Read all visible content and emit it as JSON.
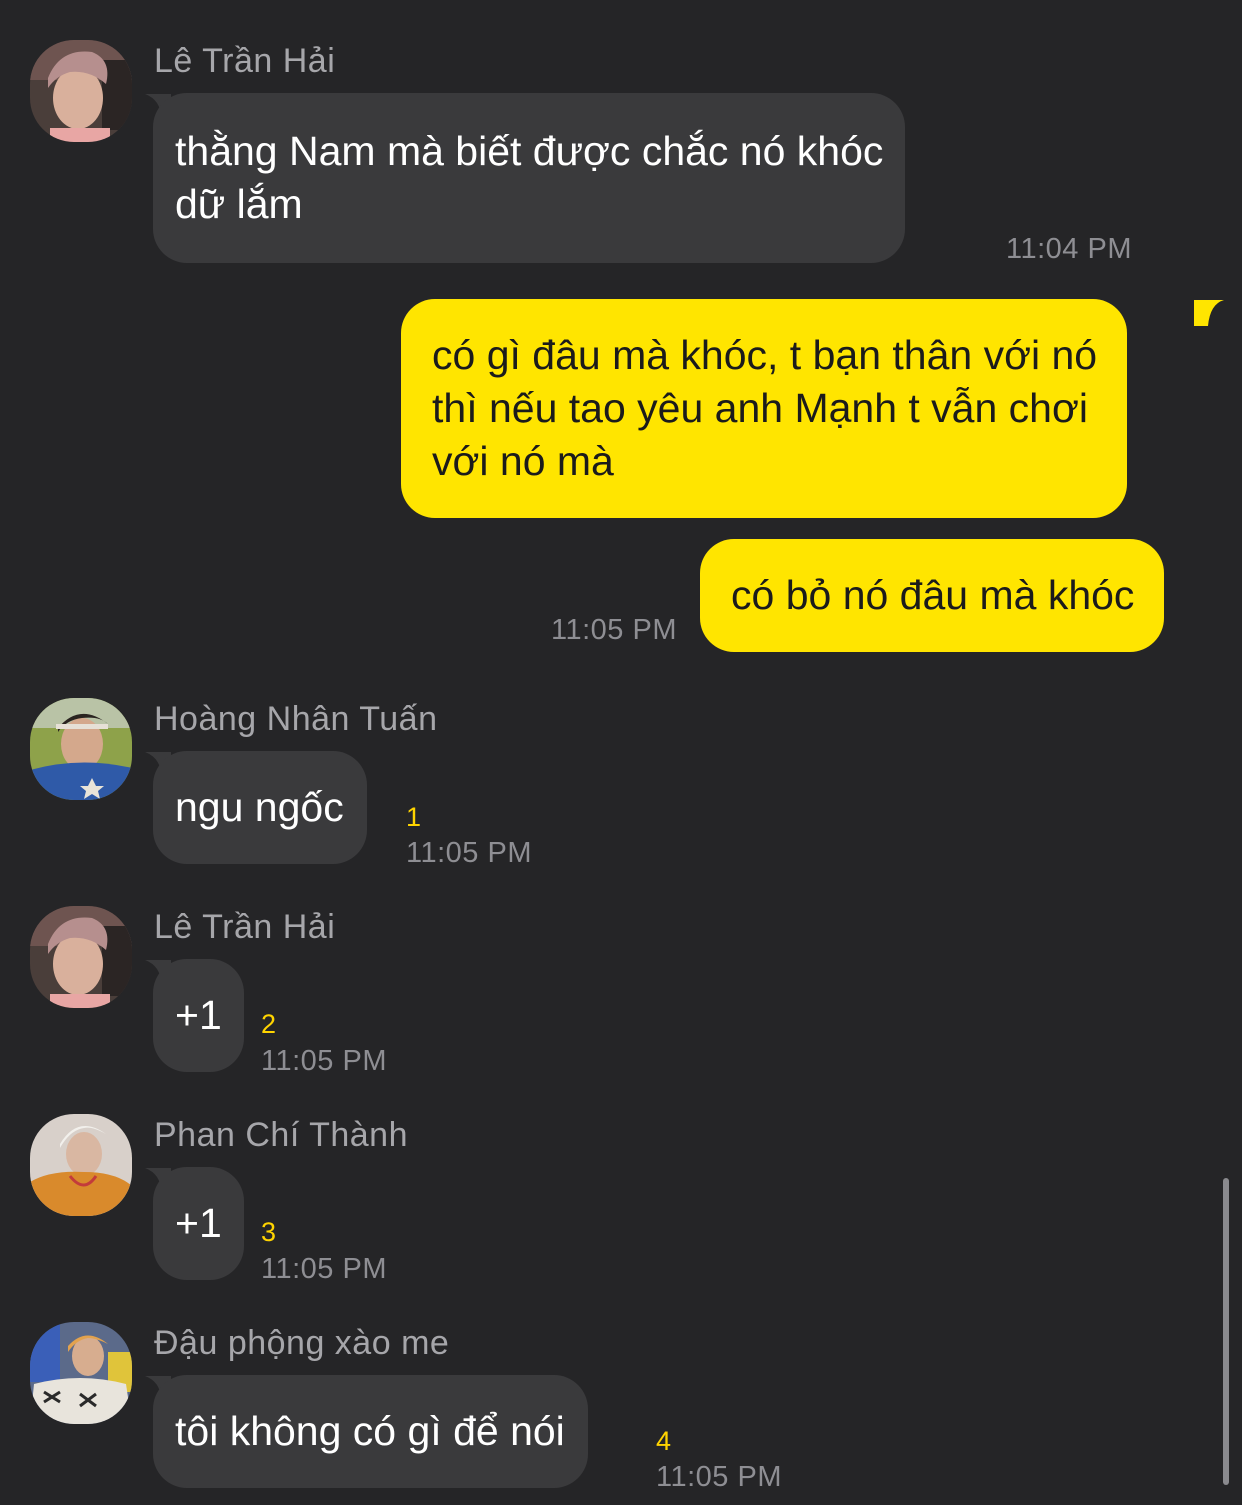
{
  "colors": {
    "background": "#252527",
    "incoming_bubble": "#3a3a3c",
    "outgoing_bubble": "#ffe500",
    "unread_count": "#ffd400",
    "timestamp": "#8e8e93",
    "sender_name": "#a6a6aa"
  },
  "messages": [
    {
      "sender": "Lê Trần Hải",
      "lines": [
        "thằng Nam mà biết được chắc nó khóc",
        "dữ lắm"
      ],
      "time": "11:04 PM",
      "direction": "incoming"
    },
    {
      "lines": [
        "có gì đâu mà khóc, t bạn thân với nó",
        "thì nếu tao yêu anh Mạnh t vẫn chơi",
        "với nó mà"
      ],
      "direction": "outgoing"
    },
    {
      "lines": [
        "có bỏ nó đâu mà khóc"
      ],
      "time": "11:05 PM",
      "direction": "outgoing"
    },
    {
      "sender": "Hoàng Nhân Tuấn",
      "lines": [
        "ngu ngốc"
      ],
      "count": "1",
      "time": "11:05 PM",
      "direction": "incoming"
    },
    {
      "sender": "Lê Trần Hải",
      "lines": [
        "+1"
      ],
      "count": "2",
      "time": "11:05 PM",
      "direction": "incoming"
    },
    {
      "sender": "Phan Chí Thành",
      "lines": [
        "+1"
      ],
      "count": "3",
      "time": "11:05 PM",
      "direction": "incoming"
    },
    {
      "sender": "Đậu phộng xào me",
      "lines": [
        "tôi không có gì để nói"
      ],
      "count": "4",
      "time": "11:05 PM",
      "direction": "incoming"
    }
  ]
}
